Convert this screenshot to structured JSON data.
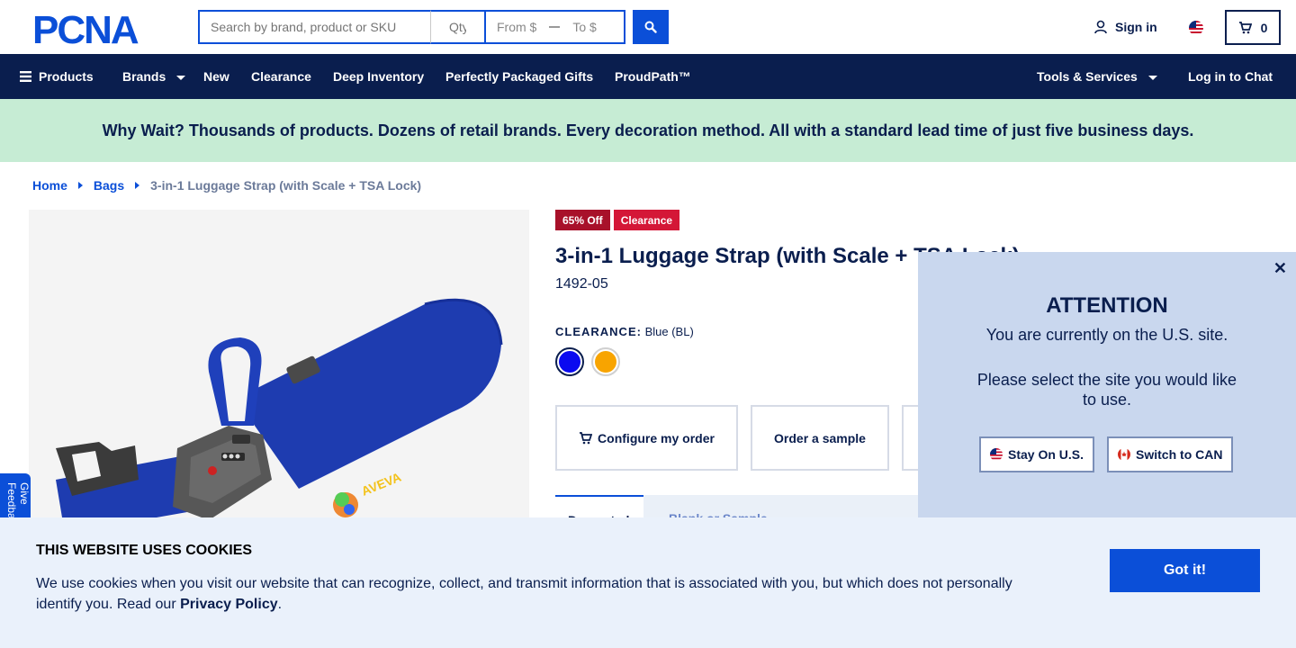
{
  "header": {
    "logo_text": "PCNA",
    "search_placeholder": "Search by brand, product or SKU",
    "qty_placeholder": "Qty",
    "price_from": "From $",
    "price_to": "To $",
    "signin_label": "Sign in",
    "cart_count": "0"
  },
  "nav": {
    "products": "Products",
    "brands": "Brands",
    "new": "New",
    "clearance": "Clearance",
    "deep_inventory": "Deep Inventory",
    "gifts": "Perfectly Packaged Gifts",
    "proudpath": "ProudPath™",
    "tools": "Tools & Services",
    "chat": "Log in to Chat"
  },
  "banner": {
    "text": "Why Wait? Thousands of products. Dozens of retail brands. Every decoration method. All with a standard lead time of just five business days."
  },
  "breadcrumb": {
    "home": "Home",
    "bags": "Bags",
    "current": "3-in-1 Luggage Strap (with Scale + TSA Lock)"
  },
  "product": {
    "badge_off": "65% Off",
    "badge_clearance": "Clearance",
    "title": "3-in-1 Luggage Strap (with Scale + TSA Lock)",
    "sku": "1492-05",
    "color_key": "CLEARANCE:",
    "color_value": "Blue (BL)",
    "swatches": [
      {
        "name": "Blue",
        "color": "#0a0af0"
      },
      {
        "name": "Orange",
        "color": "#f8a400"
      }
    ],
    "configure_label": "Configure my order",
    "sample_label": "Order a sample",
    "tab_active": "Decorated",
    "tab_inactive": "Blank or Sample",
    "image_logo_text": "AVEVA"
  },
  "feedback": {
    "label": "Give Feedback"
  },
  "attention": {
    "title": "ATTENTION",
    "message1": "You are currently on the U.S. site.",
    "message2": "Please select the site you would like to use.",
    "stay_label": "Stay On U.S.",
    "switch_label": "Switch to CAN"
  },
  "cookie": {
    "title": "THIS WEBSITE USES COOKIES",
    "text": "We use cookies when you visit our website that can recognize, collect, and transmit information that is associated with you, but which does not personally identify you. Read our ",
    "link": "Privacy Policy",
    "period": ".",
    "button": "Got it!"
  },
  "colors": {
    "brand_navy": "#0a1e4e",
    "brand_blue": "#0b4fd8",
    "banner_green": "#c6ecd4",
    "clearance_red": "#d41737"
  }
}
